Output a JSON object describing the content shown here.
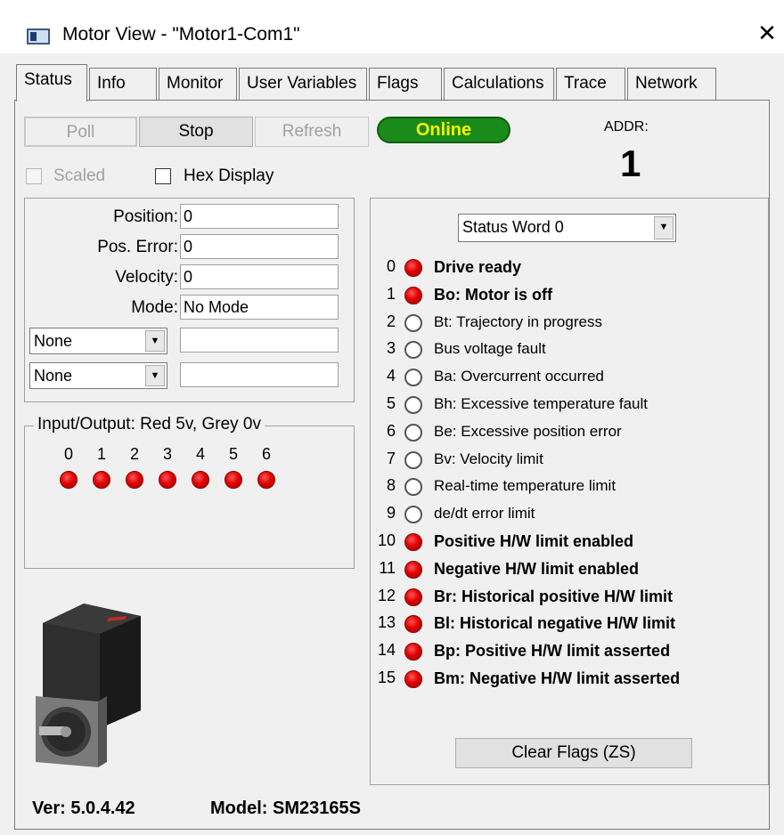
{
  "window": {
    "title": "Motor View - \"Motor1-Com1\"",
    "close_symbol": "✕"
  },
  "tabs": [
    {
      "label": "Status",
      "active": true
    },
    {
      "label": "Info"
    },
    {
      "label": "Monitor"
    },
    {
      "label": "User Variables"
    },
    {
      "label": "Flags"
    },
    {
      "label": "Calculations"
    },
    {
      "label": "Trace"
    },
    {
      "label": "Network"
    }
  ],
  "toolbar": {
    "poll_label": "Poll",
    "stop_label": "Stop",
    "refresh_label": "Refresh",
    "status_text": "Online",
    "status_color": "#1a8a1a"
  },
  "address": {
    "label": "ADDR:",
    "value": "1"
  },
  "options": {
    "scaled_label": "Scaled",
    "hex_label": "Hex Display"
  },
  "readouts": {
    "position_label": "Position:",
    "position_value": "0",
    "pos_error_label": "Pos. Error:",
    "pos_error_value": "0",
    "velocity_label": "Velocity:",
    "velocity_value": "0",
    "mode_label": "Mode:",
    "mode_value": "No Mode",
    "select1_value": "None",
    "select1_field": "",
    "select2_value": "None",
    "select2_field": ""
  },
  "io": {
    "title": "Input/Output: Red 5v, Grey 0v",
    "pins": [
      "0",
      "1",
      "2",
      "3",
      "4",
      "5",
      "6"
    ],
    "pin_states": [
      "red",
      "red",
      "red",
      "red",
      "red",
      "red",
      "red"
    ]
  },
  "status_word": {
    "selected": "Status Word 0",
    "flags": [
      {
        "num": "0",
        "text": "Drive ready",
        "state": "red",
        "bold": true
      },
      {
        "num": "1",
        "text": "Bo:  Motor is off",
        "state": "red",
        "bold": true
      },
      {
        "num": "2",
        "text": "Bt:  Trajectory in progress",
        "state": "grey",
        "bold": false
      },
      {
        "num": "3",
        "text": "Bus voltage fault",
        "state": "grey",
        "bold": false
      },
      {
        "num": "4",
        "text": "Ba:  Overcurrent occurred",
        "state": "grey",
        "bold": false
      },
      {
        "num": "5",
        "text": "Bh:  Excessive temperature fault",
        "state": "grey",
        "bold": false
      },
      {
        "num": "6",
        "text": "Be:  Excessive position error",
        "state": "grey",
        "bold": false
      },
      {
        "num": "7",
        "text": "Bv:  Velocity limit",
        "state": "grey",
        "bold": false
      },
      {
        "num": "8",
        "text": "Real-time temperature limit",
        "state": "grey",
        "bold": false
      },
      {
        "num": "9",
        "text": "de/dt error limit",
        "state": "grey",
        "bold": false
      },
      {
        "num": "10",
        "text": "Positive H/W limit enabled",
        "state": "red",
        "bold": true
      },
      {
        "num": "11",
        "text": "Negative H/W limit enabled",
        "state": "red",
        "bold": true
      },
      {
        "num": "12",
        "text": "Br:  Historical positive H/W limit",
        "state": "red",
        "bold": true
      },
      {
        "num": "13",
        "text": "Bl:  Historical negative H/W limit",
        "state": "red",
        "bold": true
      },
      {
        "num": "14",
        "text": "Bp:  Positive H/W limit asserted",
        "state": "red",
        "bold": true
      },
      {
        "num": "15",
        "text": "Bm:  Negative H/W limit asserted",
        "state": "red",
        "bold": true
      }
    ],
    "clear_label": "Clear Flags (ZS)"
  },
  "footer": {
    "version": "Ver: 5.0.4.42",
    "model": "Model: SM23165S"
  }
}
